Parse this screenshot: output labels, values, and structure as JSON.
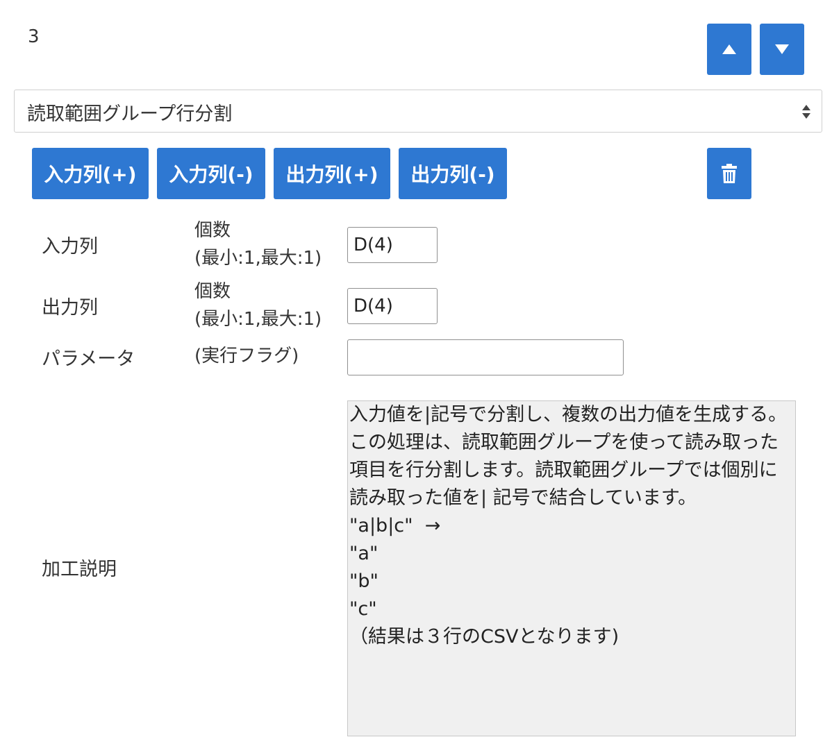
{
  "step": {
    "number": "3"
  },
  "process_select": {
    "value": "読取範囲グループ行分割"
  },
  "actions": {
    "add_input": "入力列(+)",
    "remove_input": "入力列(-)",
    "add_output": "出力列(+)",
    "remove_output": "出力列(-)"
  },
  "icons": {
    "move_up": "triangle-up-icon",
    "move_down": "triangle-down-icon",
    "delete": "trash-icon",
    "select_arrows": "sort-arrows-icon"
  },
  "input_column": {
    "label": "入力列",
    "count_label": "個数",
    "range_label": "(最小:1,最大:1)",
    "value": "D(4)"
  },
  "output_column": {
    "label": "出力列",
    "count_label": "個数",
    "range_label": "(最小:1,最大:1)",
    "value": "D(4)"
  },
  "parameter": {
    "label": "パラメータ",
    "sub_label": "(実行フラグ)",
    "value": ""
  },
  "description": {
    "label": "加工説明",
    "text": "入力値を|記号で分割し、複数の出力値を生成する。\nこの処理は、読取範囲グループを使って読み取った\n項目を行分割します。読取範囲グループでは個別に\n読み取った値を| 記号で結合しています。\n\"a|b|c\"  →\n\"a\"\n\"b\"\n\"c\"\n（結果は３行のCSVとなります)"
  },
  "colors": {
    "primary": "#2e78d2",
    "textarea_bg": "#f0f0f0"
  }
}
